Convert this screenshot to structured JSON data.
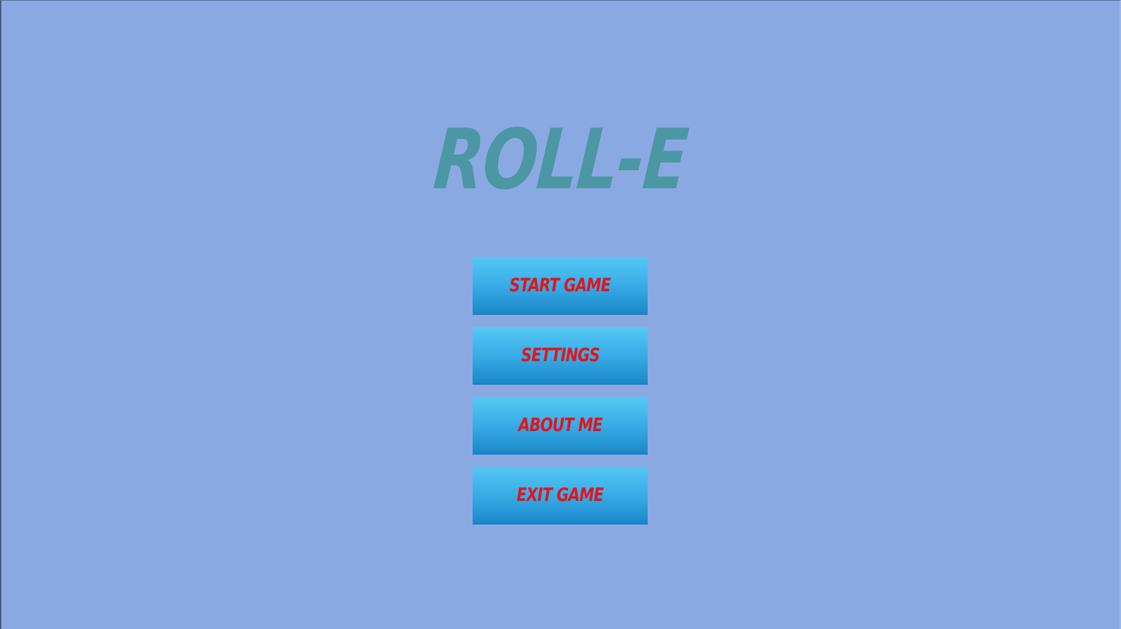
{
  "game": {
    "title": "ROLL-E"
  },
  "menu": {
    "items": [
      {
        "label": "START GAME"
      },
      {
        "label": "SETTINGS"
      },
      {
        "label": "ABOUT ME"
      },
      {
        "label": "EXIT GAME"
      }
    ]
  },
  "colors": {
    "background": "#8aa9e3",
    "title": "#4b97a4",
    "button_top": "#55c8f5",
    "button_bottom": "#1a88c8",
    "button_text": "#e3141c"
  }
}
